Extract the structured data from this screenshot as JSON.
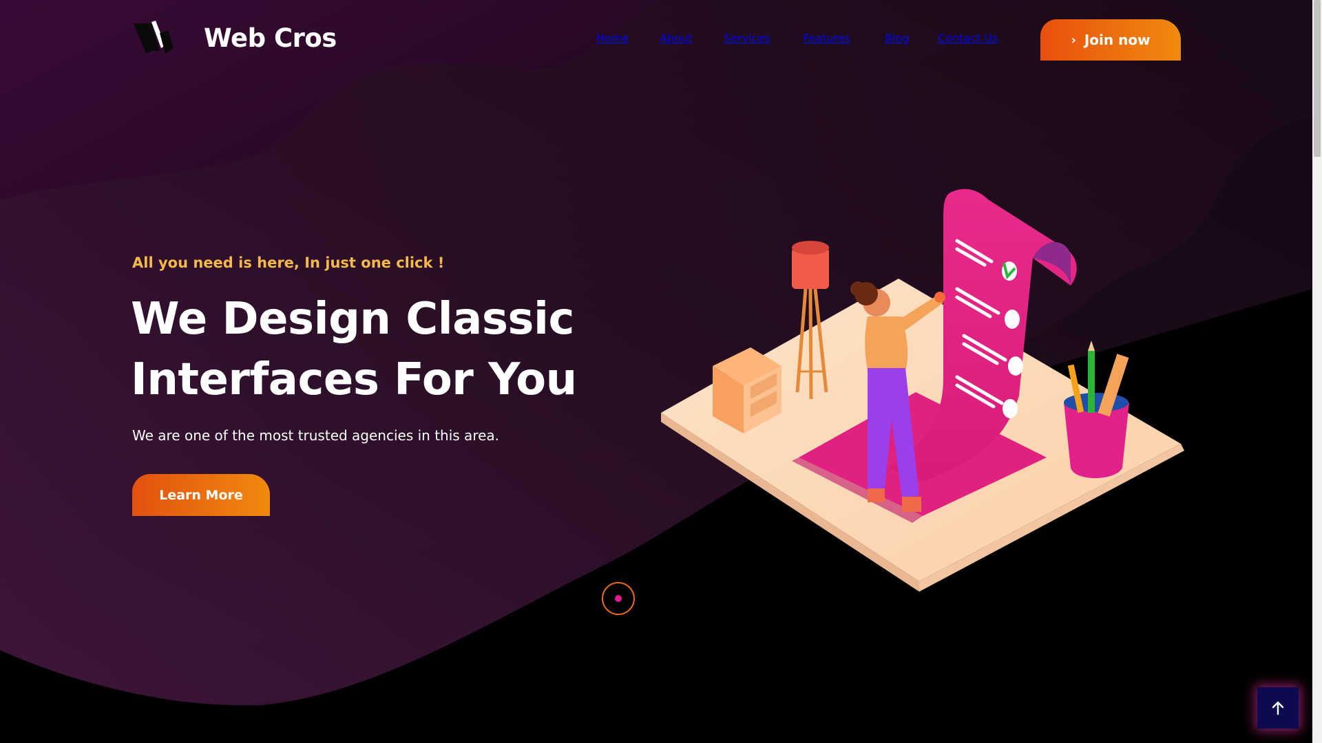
{
  "header": {
    "brand": "Web Cros",
    "nav": [
      {
        "label": "Home"
      },
      {
        "label": "About"
      },
      {
        "label": "Services"
      },
      {
        "label": "Features"
      },
      {
        "label": "Blog"
      },
      {
        "label": "Contact Us"
      }
    ],
    "join_button": {
      "label": "Join now",
      "icon": "chevron-right-icon"
    }
  },
  "hero": {
    "tagline": "All you need is here, In just one click !",
    "headline_line1": "We Design Classic",
    "headline_line2": "Interfaces For You",
    "subtext": "We are one of the most trusted agencies in this area.",
    "cta_label": "Learn More"
  },
  "slider": {
    "active_index": 1,
    "total": 1
  },
  "back_to_top": {
    "icon": "arrow-up-icon"
  },
  "colors": {
    "background_dark": "#000000",
    "wave_purple": "#2e0f2a",
    "accent_orange": "#ea580c",
    "accent_orange_light": "#f08a0e",
    "tagline_yellow": "#f5b84c",
    "magenta": "#e0217f",
    "back_top_navy": "#0c0b52"
  }
}
